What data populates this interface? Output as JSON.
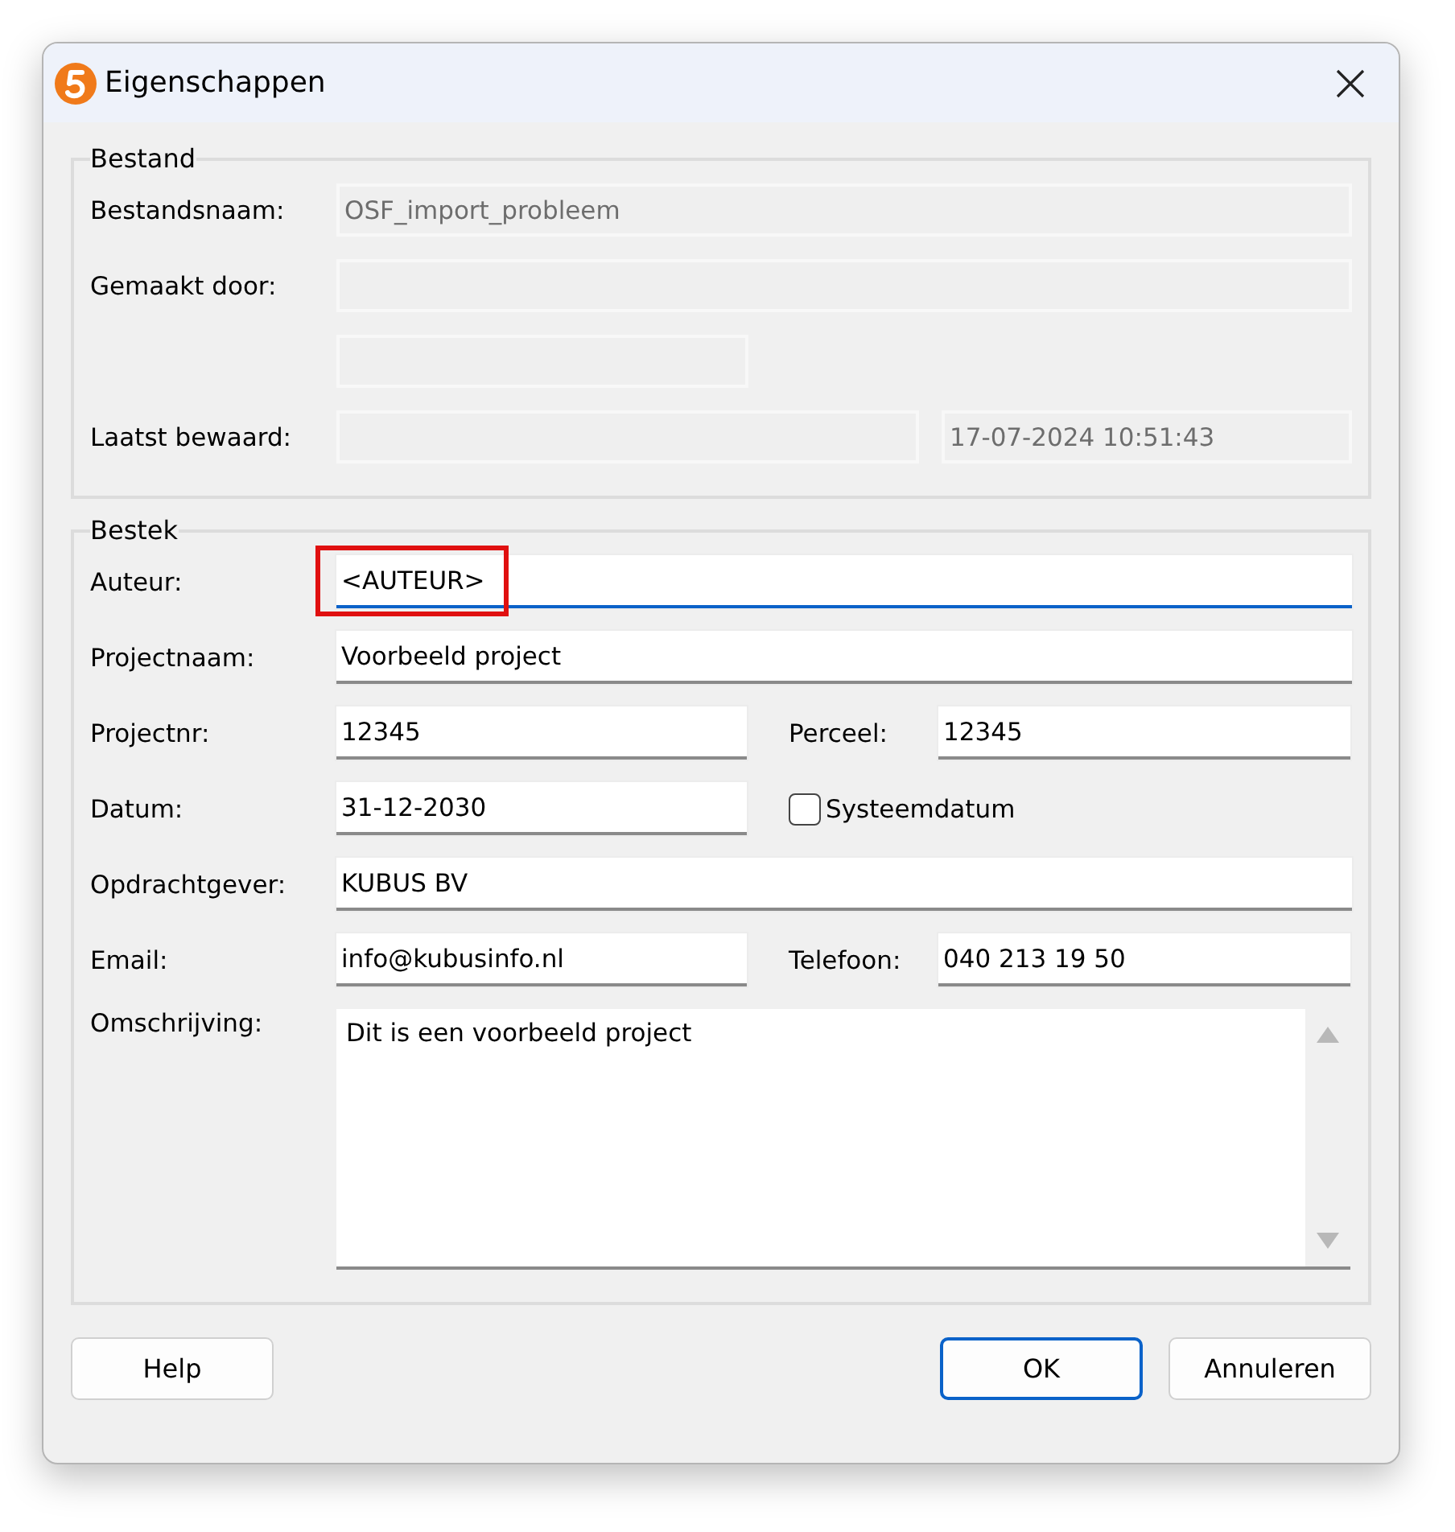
{
  "window": {
    "title": "Eigenschappen"
  },
  "groups": [
    {
      "legend": "Bestand",
      "rows": [
        {
          "kind": "full",
          "label": "Bestandsnaam:",
          "fields": [
            {
              "value": "OSF_import_probleem",
              "disabled": true
            }
          ]
        },
        {
          "kind": "full",
          "label": "Gemaakt door:",
          "fields": [
            {
              "disabled": true
            }
          ]
        },
        {
          "kind": "short",
          "fields": [
            {
              "disabled": true
            }
          ]
        },
        {
          "kind": "pair",
          "label": "Laatst bewaard:",
          "fields": [
            {
              "disabled": true
            },
            {
              "value": "17-07-2024 10:51:43",
              "disabled": true
            }
          ]
        }
      ]
    },
    {
      "legend": "Bestek",
      "rows": [
        {
          "kind": "full",
          "label": "Auteur:",
          "fields": [
            {
              "value": "<AUTEUR>",
              "disabled": false,
              "focused": true,
              "highlighted": true
            }
          ]
        },
        {
          "kind": "full",
          "label": "Projectnaam:",
          "fields": [
            {
              "value": "Voorbeeld project",
              "disabled": false,
              "focused": false,
              "highlighted": false
            }
          ]
        },
        {
          "kind": "split",
          "label": "Projectnr:",
          "fields": [
            {
              "value": "12345",
              "disabled": false,
              "focused": false,
              "highlighted": false
            },
            {
              "label": "Perceel:",
              "value": "12345",
              "disabled": false,
              "focused": false,
              "highlighted": false
            }
          ]
        },
        {
          "kind": "check",
          "label": "Datum:",
          "fields": [
            {
              "value": "31-12-2030",
              "disabled": false,
              "focused": false,
              "highlighted": false
            }
          ],
          "checkbox": {
            "label": "Systeemdatum",
            "checked": false
          }
        },
        {
          "kind": "full",
          "label": "Opdrachtgever:",
          "fields": [
            {
              "value": "KUBUS BV",
              "disabled": false,
              "focused": false,
              "highlighted": false
            }
          ]
        },
        {
          "kind": "split",
          "label": "Email:",
          "fields": [
            {
              "value": "info@kubusinfo.nl",
              "disabled": false,
              "focused": false,
              "highlighted": false
            },
            {
              "label": "Telefoon:",
              "value": "040 213 19 50",
              "disabled": false,
              "focused": false,
              "highlighted": false
            }
          ]
        },
        {
          "kind": "memo",
          "label": "Omschrijving:",
          "fields": [
            {
              "value": "Dit is een voorbeeld project",
              "focused": false
            }
          ]
        }
      ]
    }
  ],
  "buttons": [
    {
      "label": "Help",
      "default": false
    },
    {
      "label": "OK",
      "default": true
    },
    {
      "label": "Annuleren",
      "default": false
    }
  ]
}
